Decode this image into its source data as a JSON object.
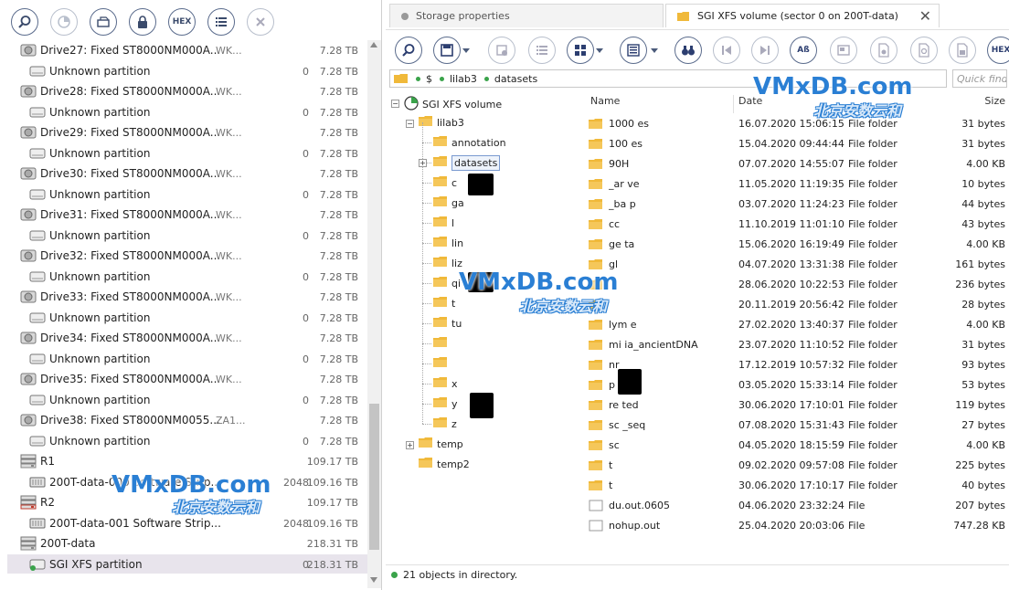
{
  "left_toolbar": {
    "buttons": [
      {
        "name": "find-icon",
        "label": ""
      },
      {
        "name": "scan-icon",
        "label": ""
      },
      {
        "name": "open-icon",
        "label": ""
      },
      {
        "name": "lock-icon",
        "label": ""
      },
      {
        "name": "hex-icon",
        "label": "HEX"
      },
      {
        "name": "list-icon",
        "label": ""
      },
      {
        "name": "close-icon",
        "label": ""
      }
    ]
  },
  "left_list": [
    {
      "type": "drive",
      "name": "Drive27: Fixed ST8000NM000A...",
      "serial": "WK...",
      "num": "",
      "size": "7.28 TB"
    },
    {
      "type": "partition",
      "name": "Unknown partition",
      "serial": "",
      "num": "0",
      "size": "7.28 TB"
    },
    {
      "type": "drive",
      "name": "Drive28: Fixed ST8000NM000A...",
      "serial": "WK...",
      "num": "",
      "size": "7.28 TB"
    },
    {
      "type": "partition",
      "name": "Unknown partition",
      "serial": "",
      "num": "0",
      "size": "7.28 TB"
    },
    {
      "type": "drive",
      "name": "Drive29: Fixed ST8000NM000A...",
      "serial": "WK...",
      "num": "",
      "size": "7.28 TB"
    },
    {
      "type": "partition",
      "name": "Unknown partition",
      "serial": "",
      "num": "0",
      "size": "7.28 TB"
    },
    {
      "type": "drive",
      "name": "Drive30: Fixed ST8000NM000A...",
      "serial": "WK...",
      "num": "",
      "size": "7.28 TB"
    },
    {
      "type": "partition",
      "name": "Unknown partition",
      "serial": "",
      "num": "0",
      "size": "7.28 TB"
    },
    {
      "type": "drive",
      "name": "Drive31: Fixed ST8000NM000A...",
      "serial": "WK...",
      "num": "",
      "size": "7.28 TB"
    },
    {
      "type": "partition",
      "name": "Unknown partition",
      "serial": "",
      "num": "0",
      "size": "7.28 TB"
    },
    {
      "type": "drive",
      "name": "Drive32: Fixed ST8000NM000A...",
      "serial": "WK...",
      "num": "",
      "size": "7.28 TB"
    },
    {
      "type": "partition",
      "name": "Unknown partition",
      "serial": "",
      "num": "0",
      "size": "7.28 TB"
    },
    {
      "type": "drive",
      "name": "Drive33: Fixed ST8000NM000A...",
      "serial": "WK...",
      "num": "",
      "size": "7.28 TB"
    },
    {
      "type": "partition",
      "name": "Unknown partition",
      "serial": "",
      "num": "0",
      "size": "7.28 TB"
    },
    {
      "type": "drive",
      "name": "Drive34: Fixed ST8000NM000A...",
      "serial": "WK...",
      "num": "",
      "size": "7.28 TB"
    },
    {
      "type": "partition",
      "name": "Unknown partition",
      "serial": "",
      "num": "0",
      "size": "7.28 TB"
    },
    {
      "type": "drive",
      "name": "Drive35: Fixed ST8000NM000A...",
      "serial": "WK...",
      "num": "",
      "size": "7.28 TB"
    },
    {
      "type": "partition",
      "name": "Unknown partition",
      "serial": "",
      "num": "0",
      "size": "7.28 TB"
    },
    {
      "type": "drive",
      "name": "Drive38: Fixed ST8000NM0055...",
      "serial": "ZA1...",
      "num": "",
      "size": "7.28 TB"
    },
    {
      "type": "partition",
      "name": "Unknown partition",
      "serial": "",
      "num": "0",
      "size": "7.28 TB"
    },
    {
      "type": "raid",
      "name": "R1",
      "serial": "",
      "num": "",
      "size": "109.17 TB"
    },
    {
      "type": "stripe",
      "name": "200T-data-000 Software Strip...",
      "serial": "",
      "num": "2048",
      "size": "109.16 TB"
    },
    {
      "type": "raid-red",
      "name": "R2",
      "serial": "",
      "num": "",
      "size": "109.17 TB"
    },
    {
      "type": "stripe",
      "name": "200T-data-001 Software Strip...",
      "serial": "",
      "num": "2048",
      "size": "109.16 TB"
    },
    {
      "type": "raid",
      "name": "200T-data",
      "serial": "",
      "num": "",
      "size": "218.31 TB"
    },
    {
      "type": "xfs",
      "name": "SGI XFS partition",
      "serial": "",
      "num": "0",
      "size": "218.31 TB",
      "selected": true
    }
  ],
  "tabs": [
    {
      "label": "Storage properties",
      "active": false
    },
    {
      "label": "SGI XFS volume (sector 0 on 200T-data)",
      "active": true
    }
  ],
  "right_toolbar": {
    "buttons": [
      {
        "name": "find-icon",
        "label": ""
      },
      {
        "name": "save-icon",
        "label": ""
      },
      {
        "name": "recover-icon",
        "label": ""
      },
      {
        "name": "checklist-icon",
        "label": ""
      },
      {
        "name": "view-icon",
        "label": ""
      },
      {
        "name": "panel-icon",
        "label": ""
      },
      {
        "name": "binoculars-icon",
        "label": ""
      },
      {
        "name": "prev-icon",
        "label": ""
      },
      {
        "name": "next-icon",
        "label": ""
      },
      {
        "name": "case-icon",
        "label": "Aß"
      },
      {
        "name": "preview-icon",
        "label": ""
      },
      {
        "name": "file-settings-icon",
        "label": ""
      },
      {
        "name": "file-find-icon",
        "label": ""
      },
      {
        "name": "file-save-icon",
        "label": ""
      },
      {
        "name": "hex-icon",
        "label": "HEX"
      }
    ]
  },
  "pathbar": {
    "crumbs": [
      "$",
      "lilab3",
      "datasets"
    ]
  },
  "quickfind": {
    "placeholder": "Quick find..."
  },
  "tree": {
    "root": "SGI XFS volume",
    "level1": "lilab3",
    "level2": [
      "annotation",
      "datasets",
      "c",
      "ga",
      "l",
      "lin",
      "liz",
      "qi",
      "t",
      "tu",
      "",
      "",
      "x",
      "y",
      "z"
    ],
    "temp": "temp",
    "temp2": "temp2"
  },
  "file_headers": {
    "name": "Name",
    "date": "Date",
    "type": "",
    "size": "Size"
  },
  "files": [
    {
      "name": "1000      es",
      "date": "16.07.2020 15:06:15",
      "type": "File folder",
      "size": "31 bytes",
      "kind": "folder"
    },
    {
      "name": "100          es",
      "date": "15.04.2020 09:44:44",
      "type": "File folder",
      "size": "31 bytes",
      "kind": "folder"
    },
    {
      "name": "90H",
      "date": "07.07.2020 14:55:07",
      "type": "File folder",
      "size": "4.00 KB",
      "kind": "folder"
    },
    {
      "name": "_ar    ve",
      "date": "11.05.2020 11:19:35",
      "type": "File folder",
      "size": "10 bytes",
      "kind": "folder"
    },
    {
      "name": "_ba    p",
      "date": "03.07.2020 11:24:23",
      "type": "File folder",
      "size": "44 bytes",
      "kind": "folder"
    },
    {
      "name": "cc",
      "date": "11.10.2019 11:01:10",
      "type": "File folder",
      "size": "43 bytes",
      "kind": "folder"
    },
    {
      "name": "ge     ta",
      "date": "15.06.2020 16:19:49",
      "type": "File folder",
      "size": "4.00 KB",
      "kind": "folder"
    },
    {
      "name": "gl",
      "date": "04.07.2020 13:31:38",
      "type": "File folder",
      "size": "161 bytes",
      "kind": "folder"
    },
    {
      "name": "",
      "date": "28.06.2020 10:22:53",
      "type": "File folder",
      "size": "236 bytes",
      "kind": "folder"
    },
    {
      "name": "",
      "date": "20.11.2019 20:56:42",
      "type": "File folder",
      "size": "28 bytes",
      "kind": "folder"
    },
    {
      "name": "lym     e",
      "date": "27.02.2020 13:40:37",
      "type": "File folder",
      "size": "4.00 KB",
      "kind": "folder"
    },
    {
      "name": "mi      ia_ancientDNA",
      "date": "23.07.2020 11:10:52",
      "type": "File folder",
      "size": "31 bytes",
      "kind": "folder"
    },
    {
      "name": "nr",
      "date": "17.12.2019 10:57:32",
      "type": "File folder",
      "size": "93 bytes",
      "kind": "folder"
    },
    {
      "name": "p",
      "date": "03.05.2020 15:33:14",
      "type": "File folder",
      "size": "53 bytes",
      "kind": "folder"
    },
    {
      "name": "re     ted",
      "date": "30.06.2020 17:10:01",
      "type": "File folder",
      "size": "119 bytes",
      "kind": "folder"
    },
    {
      "name": "sc    _seq",
      "date": "07.08.2020 15:31:43",
      "type": "File folder",
      "size": "27 bytes",
      "kind": "folder"
    },
    {
      "name": "sc",
      "date": "04.05.2020 18:15:59",
      "type": "File folder",
      "size": "4.00 KB",
      "kind": "folder"
    },
    {
      "name": "t",
      "date": "09.02.2020 09:57:08",
      "type": "File folder",
      "size": "225 bytes",
      "kind": "folder"
    },
    {
      "name": "t",
      "date": "30.06.2020 17:10:17",
      "type": "File folder",
      "size": "40 bytes",
      "kind": "folder"
    },
    {
      "name": "du.out.0605",
      "date": "04.06.2020 23:32:24",
      "type": "File",
      "size": "207 bytes",
      "kind": "file"
    },
    {
      "name": "nohup.out",
      "date": "25.04.2020 20:03:06",
      "type": "File",
      "size": "747.28 KB",
      "kind": "file"
    }
  ],
  "status": {
    "text": "21 objects in directory."
  },
  "watermark": {
    "latin": "VMxDB.com",
    "chinese": "北京安数云和"
  },
  "colors": {
    "accent": "#5a6b8c",
    "folder": "#f0b93a",
    "selected": "#e8e4ec",
    "ok": "#3aa34a"
  }
}
